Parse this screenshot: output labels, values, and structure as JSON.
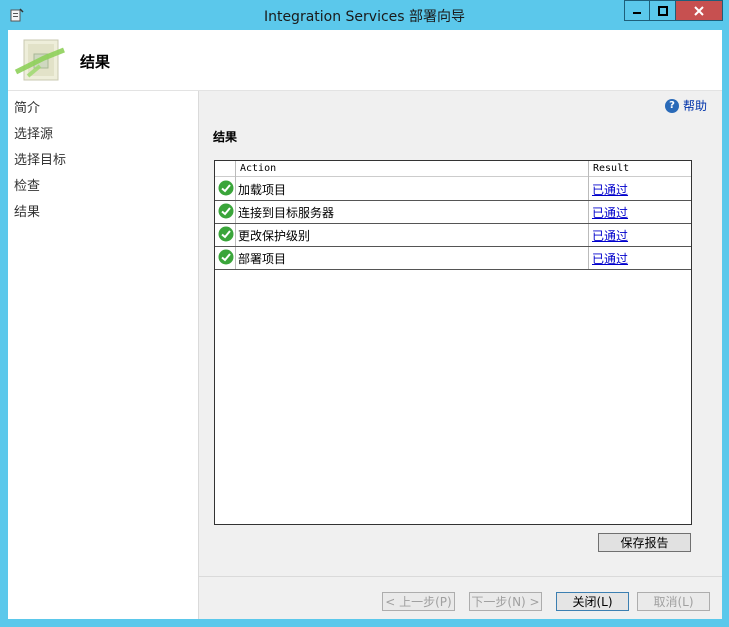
{
  "window": {
    "title": "Integration Services 部署向导",
    "icon": "package-icon"
  },
  "header": {
    "title": "结果",
    "icon": "wizard-icon"
  },
  "nav": {
    "items": [
      {
        "label": "简介"
      },
      {
        "label": "选择源"
      },
      {
        "label": "选择目标"
      },
      {
        "label": "检查"
      },
      {
        "label": "结果"
      }
    ]
  },
  "help": {
    "label": "帮助",
    "icon": "help-icon"
  },
  "main": {
    "section_title": "结果",
    "grid": {
      "columns": [
        "Action",
        "Result"
      ],
      "rows": [
        {
          "action": "加载项目",
          "result": "已通过",
          "status": "success"
        },
        {
          "action": "连接到目标服务器",
          "result": "已通过",
          "status": "success"
        },
        {
          "action": "更改保护级别",
          "result": "已通过",
          "status": "success"
        },
        {
          "action": "部署项目",
          "result": "已通过",
          "status": "success"
        }
      ]
    },
    "save_report_label": "保存报告"
  },
  "footer": {
    "prev_label": "< 上一步(P)",
    "next_label": "下一步(N) >",
    "close_label": "关闭(L)",
    "cancel_label": "取消(L)"
  },
  "colors": {
    "titlebar": "#5bc8eb",
    "close_button": "#c75050",
    "success": "#3aa53a",
    "link": "#0000cc"
  }
}
